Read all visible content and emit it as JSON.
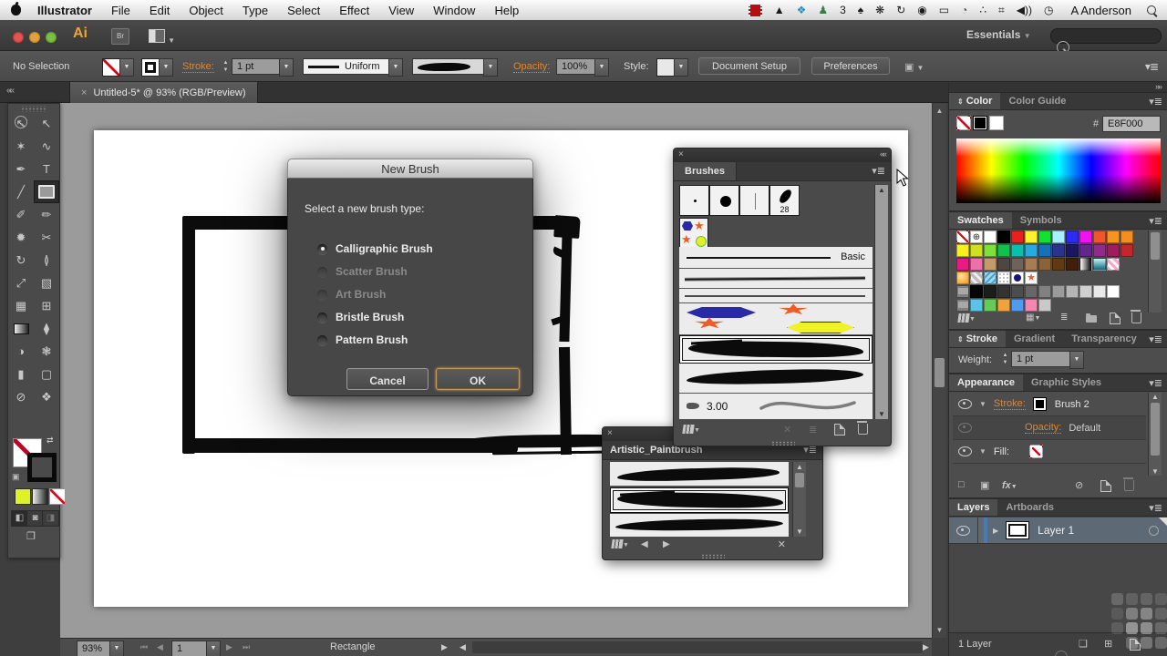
{
  "menubar": {
    "items": [
      {
        "label": "Illustrator",
        "bold": true
      },
      {
        "label": "File"
      },
      {
        "label": "Edit"
      },
      {
        "label": "Object"
      },
      {
        "label": "Type"
      },
      {
        "label": "Select"
      },
      {
        "label": "Effect"
      },
      {
        "label": "View"
      },
      {
        "label": "Window"
      },
      {
        "label": "Help"
      }
    ],
    "status_icons": [
      {
        "name": "film-icon",
        "glyph": ""
      },
      {
        "name": "flask-icon",
        "glyph": "▲",
        "color": "#1a1a1a"
      },
      {
        "name": "dropbox-icon",
        "glyph": "❖",
        "color": "#2c8fbf"
      },
      {
        "name": "stamp-icon",
        "glyph": "♟",
        "color": "#3a7d44"
      },
      {
        "name": "counter-badge",
        "glyph": "3",
        "color": "#1a1a1a"
      },
      {
        "name": "tree-icon",
        "glyph": "♠",
        "color": "#1a1a1a"
      },
      {
        "name": "paw-icon",
        "glyph": "❋",
        "color": "#1a1a1a"
      },
      {
        "name": "sync-icon",
        "glyph": "↻",
        "color": "#1a1a1a"
      },
      {
        "name": "accessibility-icon",
        "glyph": "◉",
        "color": "#1a1a1a"
      },
      {
        "name": "display-icon",
        "glyph": "▭",
        "color": "#1a1a1a"
      },
      {
        "name": "time-machine-icon",
        "glyph": "◔",
        "color": "#555"
      },
      {
        "name": "location-icon",
        "glyph": "∴",
        "color": "#1a1a1a"
      },
      {
        "name": "keyboard-icon",
        "glyph": "⌗",
        "color": "#1a1a1a"
      },
      {
        "name": "volume-icon",
        "glyph": "◀))",
        "color": "#1a1a1a"
      },
      {
        "name": "clock-icon",
        "glyph": "◷",
        "color": "#1a1a1a"
      }
    ],
    "user": "A Anderson"
  },
  "titlebar": {
    "ai_logo": "Ai",
    "br_label": "Br",
    "workspace": "Essentials"
  },
  "controlbar": {
    "no_selection": "No Selection",
    "stroke_label": "Stroke:",
    "stroke_value": "1 pt",
    "width_profile": "Uniform",
    "opacity_label": "Opacity:",
    "opacity_value": "100%",
    "style_label": "Style:",
    "document_setup": "Document Setup",
    "preferences": "Preferences"
  },
  "document_tab": {
    "title": "Untitled-5* @ 93% (RGB/Preview)"
  },
  "toolbar": {
    "tools": [
      {
        "name": "selection-tool",
        "glyph": "↖"
      },
      {
        "name": "direct-selection-tool",
        "glyph": "↖"
      },
      {
        "name": "magic-wand-tool",
        "glyph": "✶"
      },
      {
        "name": "lasso-tool",
        "glyph": "∿"
      },
      {
        "name": "pen-tool",
        "glyph": "✒"
      },
      {
        "name": "type-tool",
        "glyph": "T"
      },
      {
        "name": "line-segment-tool",
        "glyph": "╱"
      },
      {
        "name": "rectangle-tool",
        "kind": "box",
        "selected": true
      },
      {
        "name": "paintbrush-tool",
        "glyph": "✐"
      },
      {
        "name": "pencil-tool",
        "glyph": "✏"
      },
      {
        "name": "blob-brush-tool",
        "glyph": "✹"
      },
      {
        "name": "scissors-tool",
        "glyph": "✂"
      },
      {
        "name": "rotate-tool",
        "glyph": "↻"
      },
      {
        "name": "width-tool",
        "glyph": "≬"
      },
      {
        "name": "free-transform-tool",
        "glyph": "⤢"
      },
      {
        "name": "shape-builder-tool",
        "glyph": "▧"
      },
      {
        "name": "perspective-grid-tool",
        "glyph": "▦"
      },
      {
        "name": "mesh-tool",
        "glyph": "⊞"
      },
      {
        "name": "gradient-tool",
        "kind": "grad"
      },
      {
        "name": "eyedropper-tool",
        "glyph": "⧫"
      },
      {
        "name": "blend-tool",
        "glyph": "◑"
      },
      {
        "name": "symbol-sprayer-tool",
        "glyph": "❃"
      },
      {
        "name": "column-graph-tool",
        "glyph": "▮"
      },
      {
        "name": "artboard-tool",
        "glyph": "▢"
      },
      {
        "name": "slice-tool",
        "glyph": "⊘"
      },
      {
        "name": "hand-tool",
        "glyph": "❖"
      },
      {
        "name": "zoom-tool",
        "kind": "mag"
      },
      {
        "name": "blank",
        "glyph": ""
      }
    ]
  },
  "dialog": {
    "title": "New Brush",
    "prompt": "Select a new brush type:",
    "options": [
      {
        "label": "Calligraphic Brush",
        "state": "selected"
      },
      {
        "label": "Scatter Brush",
        "state": "disabled"
      },
      {
        "label": "Art Brush",
        "state": "disabled"
      },
      {
        "label": "Bristle Brush",
        "state": "enabled"
      },
      {
        "label": "Pattern Brush",
        "state": "enabled"
      }
    ],
    "cancel_label": "Cancel",
    "ok_label": "OK"
  },
  "brushes_panel": {
    "title": "Brushes",
    "calligraphic_size": "28",
    "basic_label": "Basic",
    "bristle_size": "3.00"
  },
  "artistic_panel": {
    "title": "Artistic_Paintbrush"
  },
  "color_panel": {
    "tab_color": "Color",
    "tab_color_guide": "Color Guide",
    "hex_prefix": "#",
    "hex_value": "E8F000"
  },
  "swatches_panel": {
    "tab_swatches": "Swatches",
    "tab_symbols": "Symbols",
    "rows": [
      [
        "none",
        "reg",
        "#ffffff",
        "#000000",
        "#e8211d",
        "#fff22d",
        "#12e133",
        "#a8f0ff",
        "#2b2bf5",
        "#f012f0",
        "#f2542c",
        "#f7941d",
        "#f58d20"
      ],
      [
        "#f9ef1e",
        "#cfe021",
        "#7ee03a",
        "#12c14c",
        "#0bbfae",
        "#27aae1",
        "#1472bc",
        "#2b3390",
        "#1b1765",
        "#63258e",
        "#912a8c",
        "#a01d5d",
        "#c2272e"
      ],
      [
        "#ea1a85",
        "#f06fa9",
        "#c49a6c",
        "#4f4640",
        "#6f6357",
        "#a87c53",
        "#8c6239",
        "#5f3a13",
        "#40200b",
        "grad-bw",
        "grad-cyan",
        "pat-pink",
        null
      ],
      [
        "rad-orange",
        "checker",
        "pat-blue",
        "pat-white",
        "dot-navy",
        "star-orange",
        null,
        null,
        null,
        null,
        null,
        null,
        null
      ],
      [
        "folder",
        "#060606",
        "#1c1c1c",
        "#333333",
        "#4d4d4d",
        "#676767",
        "#818181",
        "#9b9b9b",
        "#b5b5b5",
        "#cfcfcf",
        "#e9e9e9",
        "#ffffff",
        null
      ],
      [
        "folder",
        "#57c4e8",
        "#66cc55",
        "#f0a23c",
        "#4f9bf0",
        "#f585b2",
        "#c9c9c9",
        null,
        null,
        null,
        null,
        null,
        null
      ]
    ]
  },
  "stroke_panel": {
    "tab_stroke": "Stroke",
    "tab_gradient": "Gradient",
    "tab_transparency": "Transparency",
    "weight_label": "Weight:",
    "weight_value": "1 pt"
  },
  "appearance_panel": {
    "tab_appearance": "Appearance",
    "tab_graphic_styles": "Graphic Styles",
    "stroke_label": "Stroke:",
    "stroke_value": "Brush 2",
    "opacity_label": "Opacity:",
    "opacity_value": "Default",
    "fill_label": "Fill:",
    "fx_label": "fx"
  },
  "layers_panel": {
    "tab_layers": "Layers",
    "tab_artboards": "Artboards",
    "layer_name": "Layer 1",
    "count_label": "1 Layer"
  },
  "status_bar": {
    "zoom": "93%",
    "artboard_number": "1",
    "tool_name": "Rectangle"
  },
  "watermark": {
    "cells": [
      0.18,
      0.14,
      0.16,
      0.13,
      0.1,
      0.3,
      0.34,
      0.15,
      0.12,
      0.42,
      0.38,
      0.18,
      0.0,
      0.22,
      0.28,
      0.22
    ]
  }
}
